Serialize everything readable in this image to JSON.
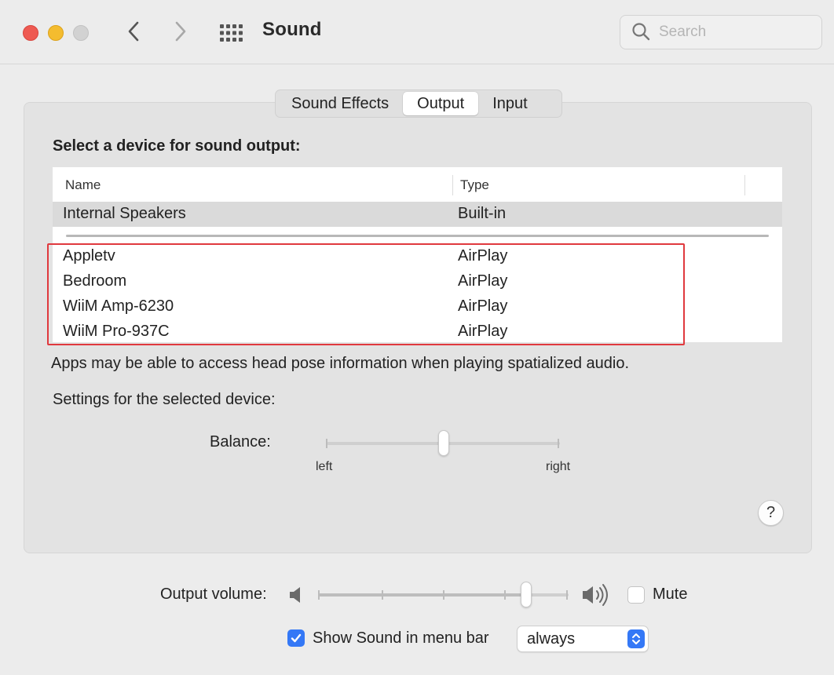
{
  "window": {
    "title": "Sound",
    "search_placeholder": "Search"
  },
  "tabs": [
    {
      "label": "Sound Effects",
      "active": false
    },
    {
      "label": "Output",
      "active": true
    },
    {
      "label": "Input",
      "active": false
    }
  ],
  "output": {
    "section_title": "Select a device for sound output:",
    "columns": [
      "Name",
      "Type"
    ],
    "devices": [
      {
        "name": "Internal Speakers",
        "type": "Built-in",
        "selected": true
      },
      {
        "name": "Appletv",
        "type": "AirPlay",
        "selected": false
      },
      {
        "name": "Bedroom",
        "type": "AirPlay",
        "selected": false
      },
      {
        "name": "WiiM Amp-6230",
        "type": "AirPlay",
        "selected": false
      },
      {
        "name": "WiiM Pro-937C",
        "type": "AirPlay",
        "selected": false
      }
    ],
    "note": "Apps may be able to access head pose information when playing spatialized audio.",
    "settings_label": "Settings for the selected device:",
    "balance": {
      "label": "Balance:",
      "left_label": "left",
      "right_label": "right",
      "value": 0.5
    },
    "help_label": "?"
  },
  "footer": {
    "volume_label": "Output volume:",
    "volume_value": 0.83,
    "mute_label": "Mute",
    "mute_checked": false,
    "show_in_menu_label": "Show Sound in menu bar",
    "show_in_menu_checked": true,
    "menu_option": "always"
  },
  "colors": {
    "accent": "#3478f6",
    "highlight_box": "#e0393e",
    "close": "#ee5a52",
    "minimize": "#f4bc2f",
    "zoom": "#d2d2d2"
  },
  "icons": {
    "back": "chevron-left-icon",
    "forward": "chevron-right-icon",
    "grid": "grid-icon",
    "search": "magnifier-icon",
    "volume_low": "speaker-low-icon",
    "volume_high": "speaker-high-icon",
    "check": "checkmark-icon",
    "popup": "up-down-chevron-icon"
  }
}
